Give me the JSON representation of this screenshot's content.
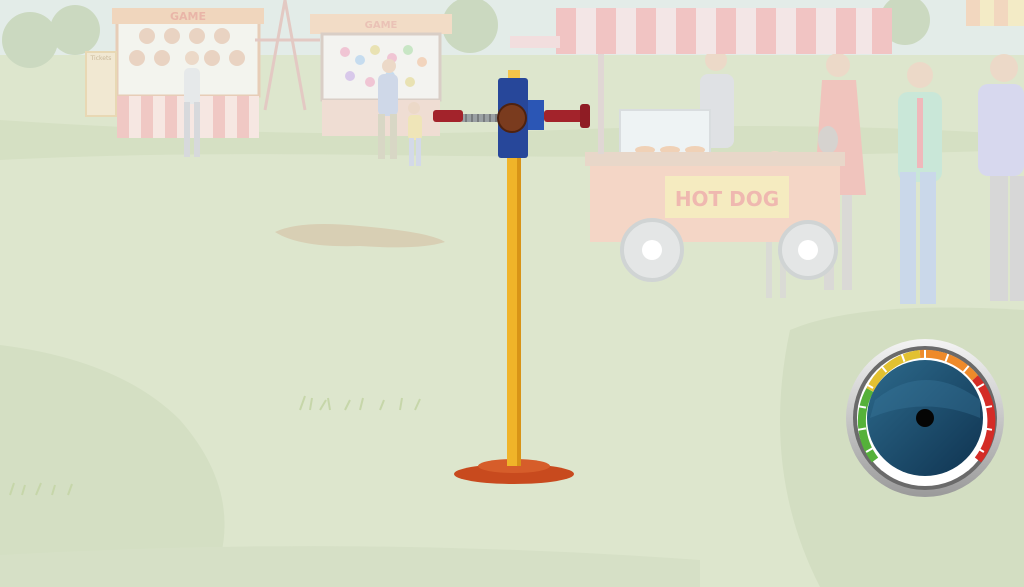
{
  "scene": {
    "sign_game_left": "GAME",
    "sign_game_center": "GAME",
    "sign_tickets": "Tickets",
    "cart_sign": "HOT DOG"
  },
  "colors": {
    "sky": "#dfe9e6",
    "grass": "#dde6cd",
    "grass_dark": "#d3dec2",
    "pole": "#f0b429",
    "clamp": "#27479a",
    "knob": "#7a3b1e",
    "handle": "#a3232b",
    "base": "#c84a1e",
    "gauge_face": "#13405e"
  },
  "game": {
    "meter": {
      "needle_value": 0,
      "scale_zones": [
        "green",
        "yellow",
        "orange",
        "red"
      ]
    }
  }
}
